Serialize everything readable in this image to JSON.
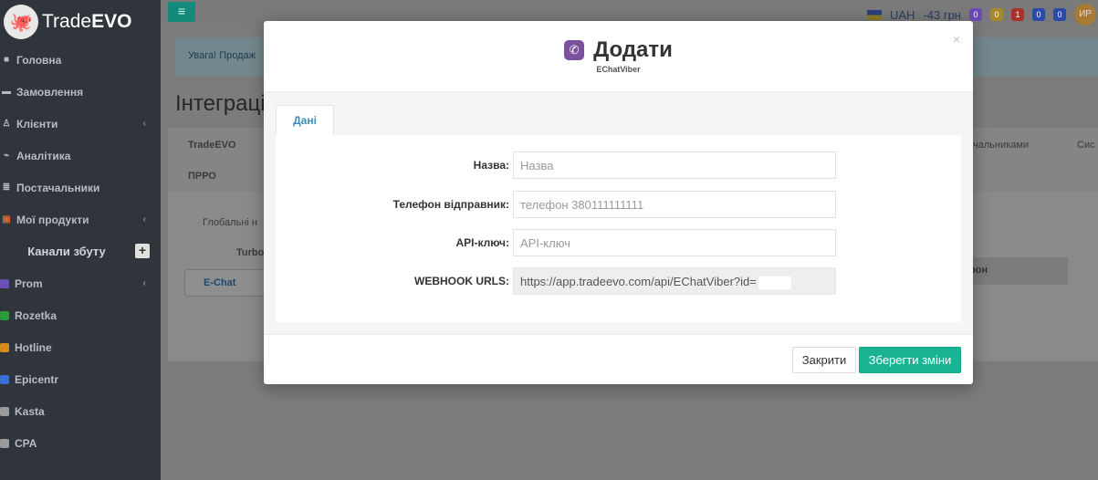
{
  "app": {
    "logo_text": "Trade",
    "logo_bold": "EVO"
  },
  "sidebar": {
    "items": [
      {
        "label": "Головна",
        "icon": "home-icon"
      },
      {
        "label": "Замовлення",
        "icon": "cart-icon"
      },
      {
        "label": "Клієнти",
        "icon": "users-icon"
      },
      {
        "label": "Аналітика",
        "icon": "chart-icon"
      },
      {
        "label": "Постачальники",
        "icon": "truck-icon"
      },
      {
        "label": "Мої продукти",
        "icon": "box-icon"
      }
    ],
    "section_title": "Канали збуту",
    "channels": [
      {
        "label": "Prom",
        "color": "#6a4fb8"
      },
      {
        "label": "Rozetka",
        "color": "#2e9a3e"
      },
      {
        "label": "Hotline",
        "color": "#d98b1a"
      },
      {
        "label": "Epicentr",
        "color": "#3a6fd8"
      },
      {
        "label": "Kasta",
        "color": "#9a9a9a"
      },
      {
        "label": "CPA",
        "color": "#9a9a9a"
      }
    ]
  },
  "topbar": {
    "currency": "UAH",
    "balance": "-43 грн",
    "badges": [
      "0",
      "0",
      "1",
      "0",
      "0"
    ],
    "avatar_initials": "ИР"
  },
  "background": {
    "alert_text": "Увага! Продаж",
    "page_title": "Інтеграції",
    "tab_tradeevo": "TradeEVO",
    "tab_prro": "ПРРО",
    "tab_suppliers": "чальниками",
    "tab_sys": "Сис",
    "global_label": "Глобальні н",
    "turbo_label": "Turbo",
    "echat_label": "E-Chat",
    "table_header": "рон"
  },
  "modal": {
    "title": "Додати",
    "subtitle": "EChatViber",
    "close_symbol": "×",
    "tab_label": "Дані",
    "fields": [
      {
        "label": "Назва:",
        "placeholder": "Назва"
      },
      {
        "label": "Телефон відправник:",
        "placeholder": "телефон 380111111111"
      },
      {
        "label": "API-ключ:",
        "placeholder": "API-ключ"
      }
    ],
    "webhook_label": "WEBHOOK URLS:",
    "webhook_value": "https://app.tradeevo.com/api/EChatViber?id=",
    "close_button": "Закрити",
    "save_button": "Зберегти зміни",
    "accent_color": "#1ab394",
    "viber_color": "#7b519d"
  }
}
